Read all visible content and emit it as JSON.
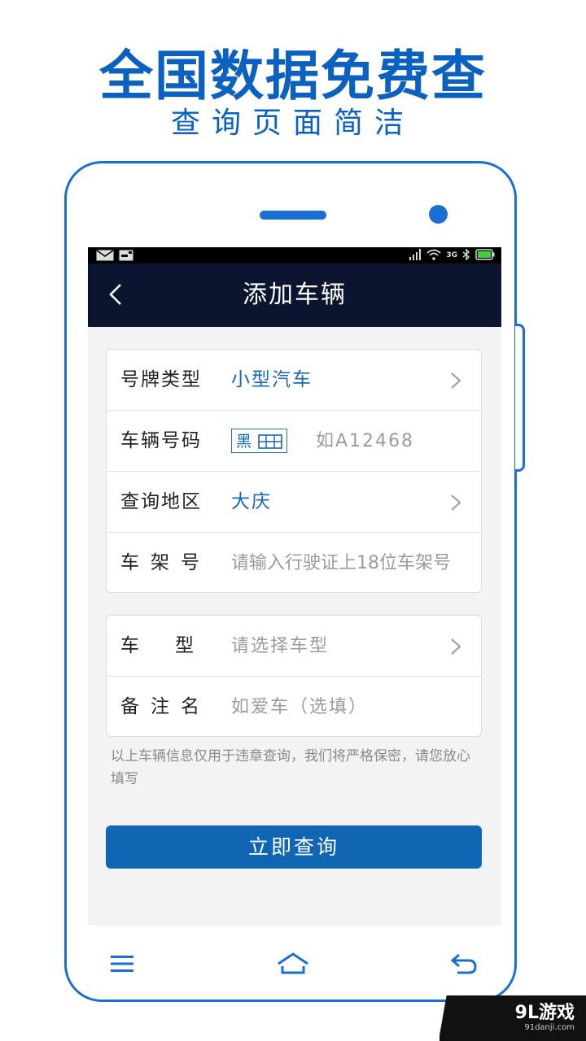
{
  "promo": {
    "headline": "全国数据免费查",
    "subline": "查询页面简洁"
  },
  "colors": {
    "brand_blue": "#0a61c0",
    "titlebar": "#0c1530",
    "value_blue": "#1667b4",
    "button_blue": "#1166b3",
    "screen_bg": "#f3f3f3"
  },
  "statusbar": {
    "left_icons": [
      "mail-icon",
      "notification-icon"
    ],
    "right_icons": [
      "signal-icon",
      "wifi-icon",
      "3g-icon",
      "bluetooth-icon",
      "battery-icon"
    ],
    "network_label": "3G"
  },
  "header": {
    "back_icon": "chevron-left-icon",
    "title": "添加车辆"
  },
  "form": {
    "plate_type": {
      "label": "号牌类型",
      "value": "小型汽车"
    },
    "plate_number": {
      "label": "车辆号码",
      "prefix": "黑",
      "placeholder": "如A12468"
    },
    "region": {
      "label": "查询地区",
      "value": "大庆"
    },
    "vin": {
      "label": "车架号",
      "placeholder": "请输入行驶证上18位车架号"
    },
    "model": {
      "label": "车型",
      "placeholder": "请选择车型"
    },
    "nickname": {
      "label": "备注名",
      "placeholder": "如爱车（选填）"
    }
  },
  "notice": "以上车辆信息仅用于违章查询，我们将严格保密，请您放心填写",
  "submit_label": "立即查询",
  "navbar": {
    "icons": [
      "menu-icon",
      "home-icon",
      "back-arrow-icon"
    ]
  },
  "watermark": {
    "main": "9L游戏",
    "sub": "91danji.com"
  }
}
